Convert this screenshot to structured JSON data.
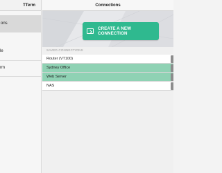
{
  "sidebar": {
    "title": "TTerm",
    "items": [
      {
        "label": "ons",
        "selected": true
      },
      {
        "label": "le",
        "selected": false
      },
      {
        "label": "rm",
        "selected": false
      }
    ]
  },
  "main": {
    "title": "Connections",
    "create_button_label": "CREATE A NEW CONNECTION",
    "section_label": "SAVED CONNECTIONS",
    "connections": [
      {
        "name": "Router (VT100)",
        "highlighted": false
      },
      {
        "name": "Sydney Office",
        "highlighted": true
      },
      {
        "name": "Web Server",
        "highlighted": true
      },
      {
        "name": "NAS",
        "highlighted": false
      }
    ]
  },
  "colors": {
    "accent_green": "#2fb98f",
    "row_green": "#8fd2b4",
    "tab_gray": "#8c8c8c"
  }
}
